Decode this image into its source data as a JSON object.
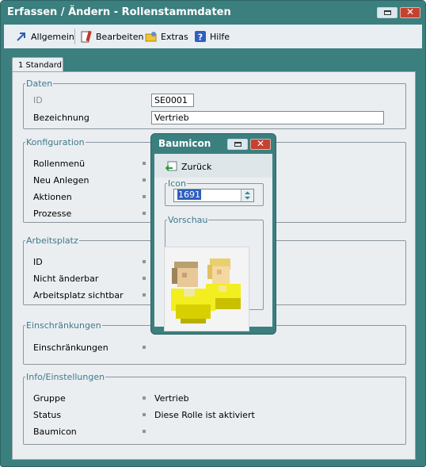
{
  "window": {
    "title": "Erfassen / Ändern - Rollenstammdaten"
  },
  "toolbar": {
    "items": [
      {
        "label": "Allgemein",
        "icon": "arrow-icon"
      },
      {
        "label": "Bearbeiten",
        "icon": "edit-icon"
      },
      {
        "label": "Extras",
        "icon": "extras-icon"
      },
      {
        "label": "Hilfe",
        "icon": "help-icon"
      }
    ]
  },
  "tabs": [
    {
      "label": "1 Standard"
    }
  ],
  "daten": {
    "legend": "Daten",
    "id_label": "ID",
    "id_value": "SE0001",
    "bezeichnung_label": "Bezeichnung",
    "bezeichnung_value": "Vertrieb"
  },
  "konfiguration": {
    "legend": "Konfiguration",
    "rows": [
      "Rollenmenü",
      "Neu Anlegen",
      "Aktionen",
      "Prozesse"
    ]
  },
  "arbeitsplatz": {
    "legend": "Arbeitsplatz",
    "rows": [
      "ID",
      "Nicht änderbar",
      "Arbeitsplatz sichtbar"
    ]
  },
  "einschraenkungen": {
    "legend": "Einschränkungen",
    "rows": [
      "Einschränkungen"
    ]
  },
  "info": {
    "legend": "Info/Einstellungen",
    "rows": [
      {
        "label": "Gruppe",
        "value": "Vertrieb"
      },
      {
        "label": "Status",
        "value": "Diese Rolle ist aktiviert"
      },
      {
        "label": "Baumicon",
        "value": ""
      }
    ]
  },
  "dialog": {
    "title": "Baumicon",
    "back_label": "Zurück",
    "icon_legend": "Icon",
    "icon_value": "1691",
    "preview_legend": "Vorschau"
  },
  "colors": {
    "frame": "#3b7f7f",
    "panel": "#eaeef1",
    "legend": "#3f7a8a"
  }
}
